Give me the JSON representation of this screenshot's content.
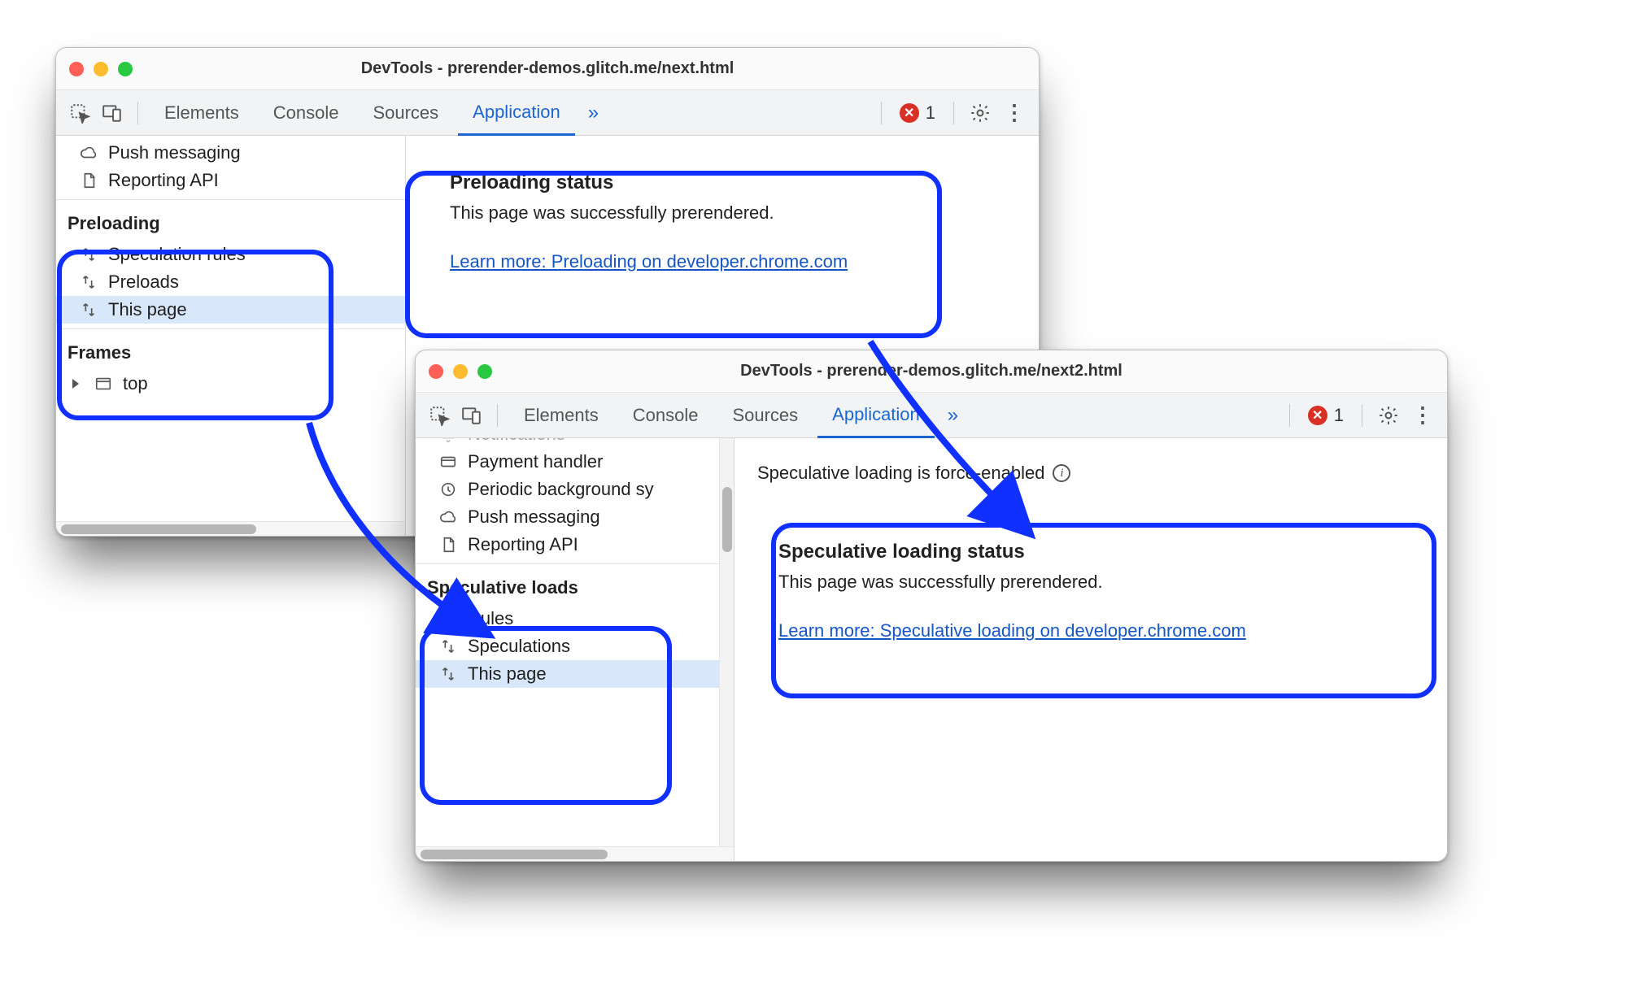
{
  "window1": {
    "title": "DevTools - prerender-demos.glitch.me/next.html",
    "tabs": [
      "Elements",
      "Console",
      "Sources",
      "Application"
    ],
    "active_tab": 3,
    "more_tabs_glyph": "»",
    "error_count": "1",
    "sidebar": {
      "pre_items": [
        {
          "icon": "cloud",
          "label": "Push messaging"
        },
        {
          "icon": "file",
          "label": "Reporting API"
        }
      ],
      "preloading_header": "Preloading",
      "preloading_items": [
        {
          "label": "Speculation rules"
        },
        {
          "label": "Preloads"
        },
        {
          "label": "This page",
          "selected": true
        }
      ],
      "frames_header": "Frames",
      "frames_items": [
        {
          "label": "top"
        }
      ]
    },
    "panel": {
      "heading": "Preloading status",
      "body": "This page was successfully prerendered.",
      "link": "Learn more: Preloading on developer.chrome.com"
    }
  },
  "window2": {
    "title": "DevTools - prerender-demos.glitch.me/next2.html",
    "tabs": [
      "Elements",
      "Console",
      "Sources",
      "Application"
    ],
    "active_tab": 3,
    "more_tabs_glyph": "»",
    "error_count": "1",
    "sidebar": {
      "bg_items": [
        {
          "icon": "bell",
          "label": "Notifications",
          "clipped": true
        },
        {
          "icon": "card",
          "label": "Payment handler"
        },
        {
          "icon": "clock",
          "label": "Periodic background sy"
        },
        {
          "icon": "cloud",
          "label": "Push messaging"
        },
        {
          "icon": "file",
          "label": "Reporting API"
        }
      ],
      "spec_header": "Speculative loads",
      "spec_items": [
        {
          "label": "Rules"
        },
        {
          "label": "Speculations"
        },
        {
          "label": "This page",
          "selected": true
        }
      ]
    },
    "status_line": "Speculative loading is force-enabled",
    "panel": {
      "heading": "Speculative loading status",
      "body": "This page was successfully prerendered.",
      "link": "Learn more: Speculative loading on developer.chrome.com"
    }
  }
}
